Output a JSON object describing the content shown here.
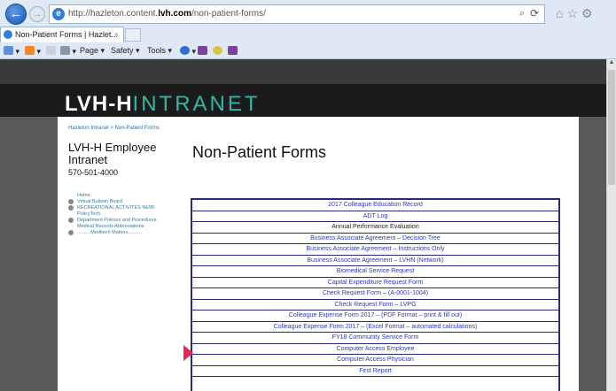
{
  "browser": {
    "url_prefix": "http://hazleton.content.",
    "url_bold": "lvh.com",
    "url_suffix": "/non-patient-forms/",
    "tab_title": "Non-Patient Forms | Hazlet...",
    "tab_close": "×",
    "search_icon_glyph": "⌕",
    "refresh_glyph": "⟳",
    "right_icons": "⌂☆⚙",
    "toolbar": {
      "page": "Page ▾",
      "safety": "Safety ▾",
      "tools": "Tools ▾"
    }
  },
  "site": {
    "logo_part1": "LVH-H",
    "logo_part2": "INTRANET"
  },
  "sidebar": {
    "breadcrumb": "Hazleton Intranet > Non-Patient Forms",
    "title": "LVH-H Employee Intranet",
    "phone": "570-501-4000",
    "nav": [
      {
        "label": "Home",
        "bullet": false
      },
      {
        "label": "Virtual Bulletin Board",
        "bullet": true
      },
      {
        "label": "RECREATIONAL ACTIVITES NEW!",
        "bullet": true
      },
      {
        "label": "PolicyTech",
        "bullet": false
      },
      {
        "label": "Department Policies and Procedures",
        "bullet": true
      },
      {
        "label": "Medical Records Abbreviations",
        "bullet": false
      },
      {
        "label": "..........Meditech Matters..........",
        "bullet": true
      }
    ]
  },
  "main": {
    "title": "Non-Patient Forms",
    "forms": [
      "2017 Colleague Education Record",
      "ADT Log",
      "Annual Performance Evaluation",
      "Business Associate Agreement – Decision Tree",
      "Business Associate Agreement – Instructions Only",
      "Business Associate Agreement – LVHN (Network)",
      "Biomedical Service Request",
      "Capital Expenditure Request Form",
      "Check Request Form – (A-0001-1004)",
      "Check Request Form – LVPG",
      "Colleague Expense Form 2017 – (PDF Format – print & fill out)",
      "Colleague Expense Form 2017 – (Excel Format – automated calculations)",
      "FY18 Community Service Form",
      "Computer Access Employee",
      "Computer Access Physician",
      "First Report"
    ]
  },
  "colors": {
    "link": "#2a38c8",
    "accent_teal": "#2fb8a8",
    "arrow_pink": "#e8245a"
  }
}
